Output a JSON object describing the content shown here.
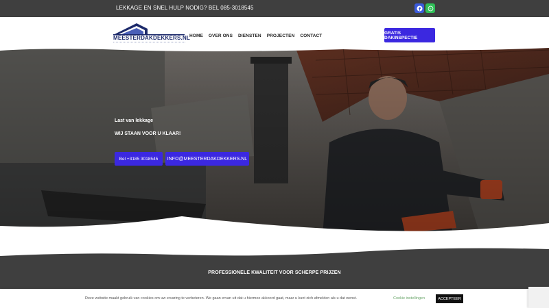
{
  "topbar": {
    "text": "LEKKAGE EN SNEL HULP NODIG? BEL 085-3018545",
    "social": [
      {
        "icon": "facebook-icon",
        "color": "#3b5bdb"
      },
      {
        "icon": "whatsapp-icon",
        "color": "#2fbf57"
      }
    ]
  },
  "header": {
    "logo_text": "MEESTERDAKDEKKERS.NL",
    "nav": [
      "HOME",
      "OVER ONS",
      "DIENSTEN",
      "PROJECTEN",
      "CONTACT"
    ],
    "cta": "GRATIS DAKINSPECTIE"
  },
  "hero": {
    "small": "Last van lekkage",
    "title": "WIJ STAAN VOOR U KLAAR!",
    "phone_button": "Bel +3185 3018545",
    "mail_button": "INFO@MEESTERDAKDEKKERS.NL"
  },
  "band": {
    "title": "PROFESSIONELE KWALITEIT VOOR SCHERPE PRIJZEN"
  },
  "cookie": {
    "text": "Deze website maakt gebruik van cookies om uw ervaring te verbeteren. We gaan ervan uit dat u hiermee akkoord gaat, maar u kunt zich afmelden als u dat wenst.",
    "settings": "Cookie instellingen",
    "accept": "ACCEPTEER"
  },
  "colors": {
    "accent": "#3b28e0",
    "dark": "#3f3f3f",
    "brand_logo": "#1d2a6b"
  }
}
